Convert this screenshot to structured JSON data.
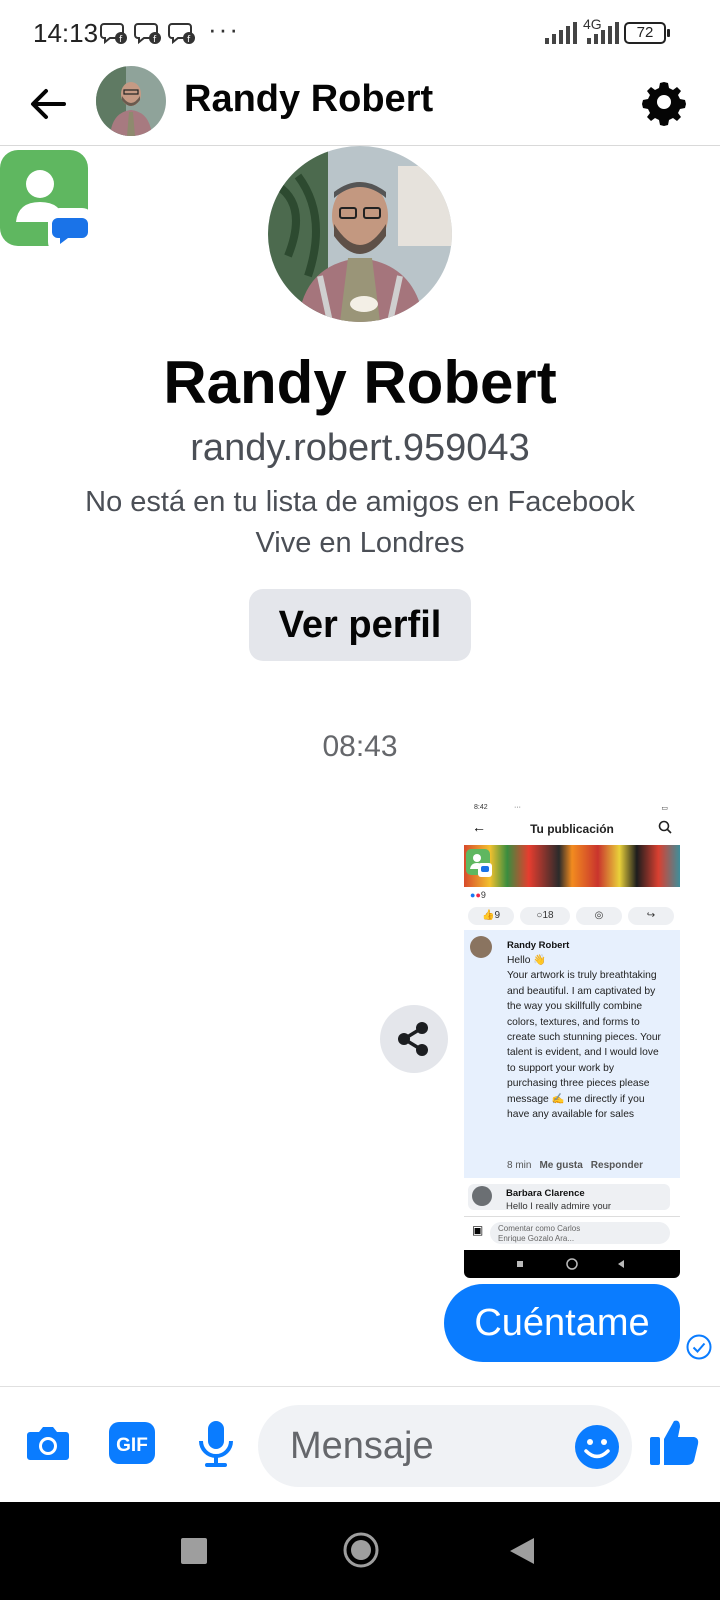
{
  "status_bar": {
    "time": "14:13",
    "dots": "···",
    "network": "4G",
    "battery": "72"
  },
  "header": {
    "contact_name": "Randy Robert"
  },
  "profile": {
    "name": "Randy Robert",
    "username": "randy.robert.959043",
    "friendship_note": "No está en tu lista de amigos en Facebook",
    "location": "Vive en Londres",
    "view_profile_label": "Ver perfil"
  },
  "conversation": {
    "timestamp": "08:43",
    "shared_screenshot": {
      "status_time": "8:42",
      "status_dots": "···",
      "title": "Tu publicación",
      "reaction_count": "9",
      "actions": [
        "9",
        "18"
      ],
      "comment_author": "Randy Robert",
      "comment_greeting": "Hello 👋",
      "comment_body": "Your artwork is truly breathtaking and beautiful. I am captivated by the way you skillfully combine colors, textures, and forms to create such stunning pieces. Your talent is evident, and I would love to support your work by purchasing three pieces please message ✍️ me directly if you have any available for sales",
      "comment_time": "8 min",
      "comment_like": "Me gusta",
      "comment_reply": "Responder",
      "second_author": "Barbara Clarence",
      "second_text": "Hello I really admire your",
      "input_placeholder": "Comentar como Carlos Enrique Gozalo Ara..."
    },
    "outgoing_message": "Cuéntame"
  },
  "composer": {
    "placeholder": "Mensaje",
    "gif_label": "GIF"
  },
  "colors": {
    "accent": "#0a7cff",
    "secondary_text": "#65676b",
    "button_bg": "#e4e6eb",
    "floating_bubble_green": "#5fb760"
  },
  "icons": [
    "back-arrow-icon",
    "gear-icon",
    "share-icon",
    "camera-icon",
    "gif-icon",
    "microphone-icon",
    "emoji-icon",
    "thumbs-up-icon",
    "delivered-check-icon",
    "recent-apps-icon",
    "home-icon",
    "back-nav-icon"
  ]
}
